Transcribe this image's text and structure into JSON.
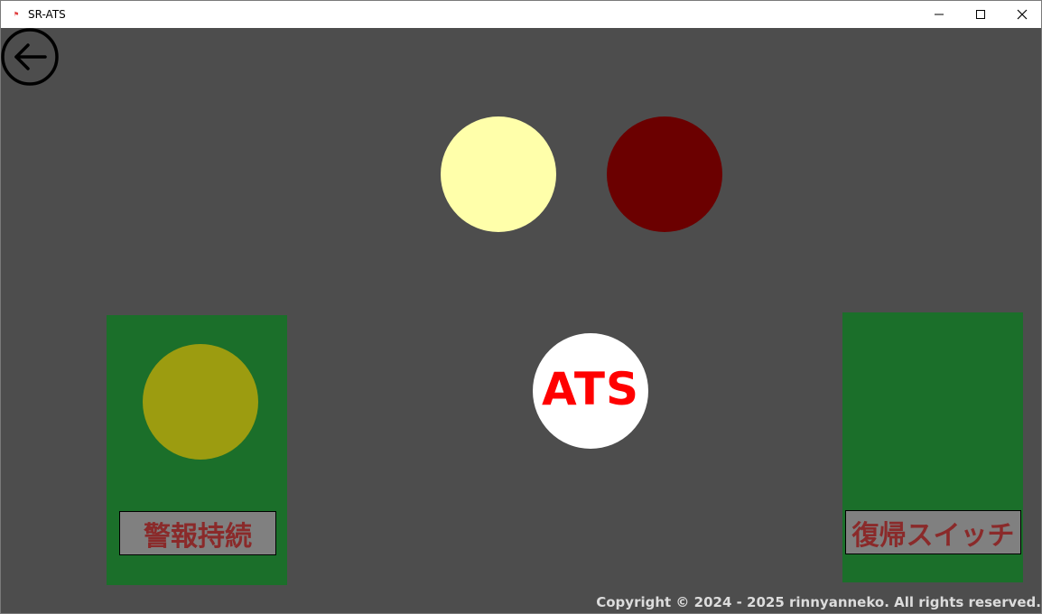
{
  "window": {
    "title": "SR-ATS",
    "app_icon": "ats-app-icon",
    "controls": [
      "minimize-icon",
      "maximize-icon",
      "close-icon"
    ]
  },
  "back_button": {
    "icon": "arrow-left-circle-icon"
  },
  "indicators": {
    "top_left_lamp": {
      "color": "#ffffaa"
    },
    "top_right_lamp": {
      "color": "#6b0000"
    },
    "ats_lamp": {
      "label": "ATS",
      "background": "#ffffff",
      "text_color": "#ff0000"
    }
  },
  "left_panel": {
    "background": "#1b6f2a",
    "lamp_color": "#9c9c10",
    "button": {
      "label": "警報持続",
      "background": "#808080",
      "text_color": "#8a2a2a"
    }
  },
  "right_panel": {
    "background": "#1b6f2a",
    "button": {
      "label": "復帰スイッチ",
      "background": "#808080",
      "text_color": "#8a2a2a"
    }
  },
  "footer": {
    "copyright": "Copyright © 2024 - 2025 rinnyanneko. All rights reserved.",
    "color": "#dcdcdc"
  },
  "colors": {
    "background": "#4d4d4d",
    "titlebar": "#ffffff"
  }
}
